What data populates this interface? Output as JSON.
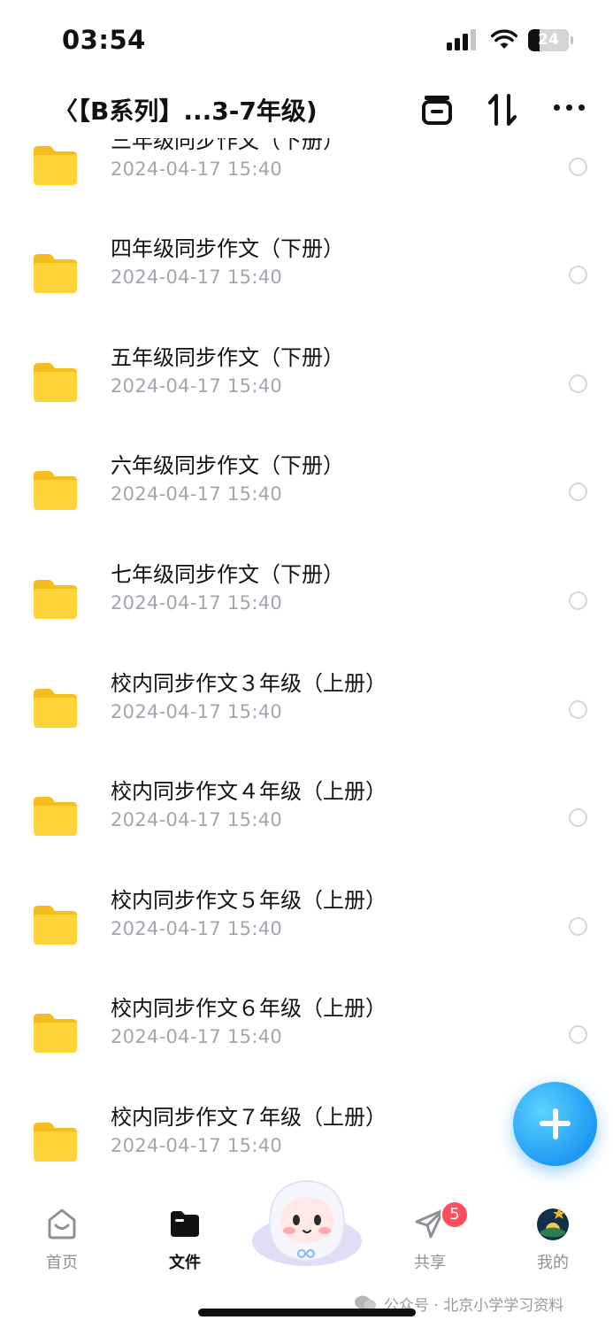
{
  "status_bar": {
    "time": "03:54",
    "battery": "24"
  },
  "header": {
    "title": "〈【B系列】...3-7年级)",
    "back_icon": "chevron-left-icon",
    "icons": [
      "archive-icon",
      "sort-icon",
      "more-icon"
    ]
  },
  "files": [
    {
      "name": "三年级同步作文（下册）",
      "date": "2024-04-17 15:40"
    },
    {
      "name": "四年级同步作文（下册）",
      "date": "2024-04-17 15:40"
    },
    {
      "name": "五年级同步作文（下册）",
      "date": "2024-04-17 15:40"
    },
    {
      "name": "六年级同步作文（下册）",
      "date": "2024-04-17 15:40"
    },
    {
      "name": "七年级同步作文（下册）",
      "date": "2024-04-17 15:40"
    },
    {
      "name": "校内同步作文３年级（上册）",
      "date": "2024-04-17 15:40"
    },
    {
      "name": "校内同步作文４年级（上册）",
      "date": "2024-04-17 15:40"
    },
    {
      "name": "校内同步作文５年级（上册）",
      "date": "2024-04-17 15:40"
    },
    {
      "name": "校内同步作文６年级（上册）",
      "date": "2024-04-17 15:40"
    },
    {
      "name": "校内同步作文７年级（上册）",
      "date": "2024-04-17 15:40"
    }
  ],
  "fab": {
    "icon": "plus-icon"
  },
  "bottom_nav": {
    "items": [
      {
        "label": "首页",
        "icon": "home-icon",
        "active": false
      },
      {
        "label": "文件",
        "icon": "folder-icon",
        "active": true
      },
      {
        "label": "共享",
        "icon": "paper-plane-icon",
        "active": false,
        "badge": "5"
      },
      {
        "label": "我的",
        "icon": "avatar-icon",
        "active": false
      }
    ]
  },
  "watermark": {
    "text": "公众号 · 北京小学学习资料"
  },
  "colors": {
    "folder": "#FFD43B",
    "accent_blue": "#1F9AF3",
    "badge_red": "#FF4D5B",
    "date_gray": "#A2A6AE"
  }
}
